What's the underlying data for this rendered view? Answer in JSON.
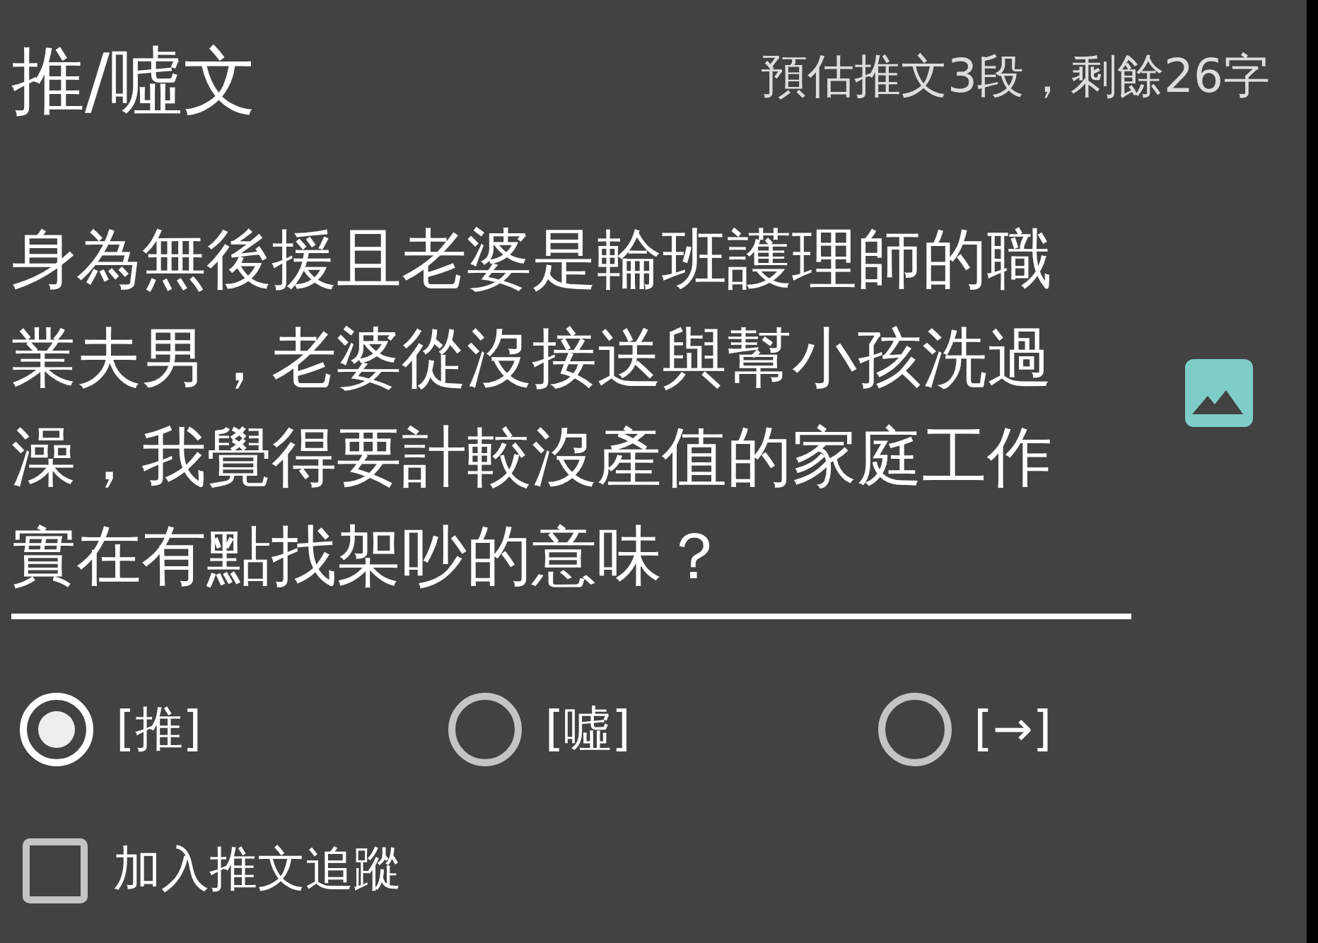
{
  "dialog": {
    "title": "推/噓文",
    "counter": "預估推文3段，剩餘26字"
  },
  "comment_field": {
    "value": "身為無後援且老婆是輪班護理師的職業夫男，老婆從沒接送與幫小孩洗過澡，我覺得要計較沒產值的家庭工作實在有點找架吵的意味？"
  },
  "options": [
    {
      "label": "[推]",
      "selected": true
    },
    {
      "label": "[噓]",
      "selected": false
    },
    {
      "label": "[→]",
      "selected": false
    }
  ],
  "track_checkbox": {
    "label": "加入推文追蹤",
    "checked": false
  }
}
